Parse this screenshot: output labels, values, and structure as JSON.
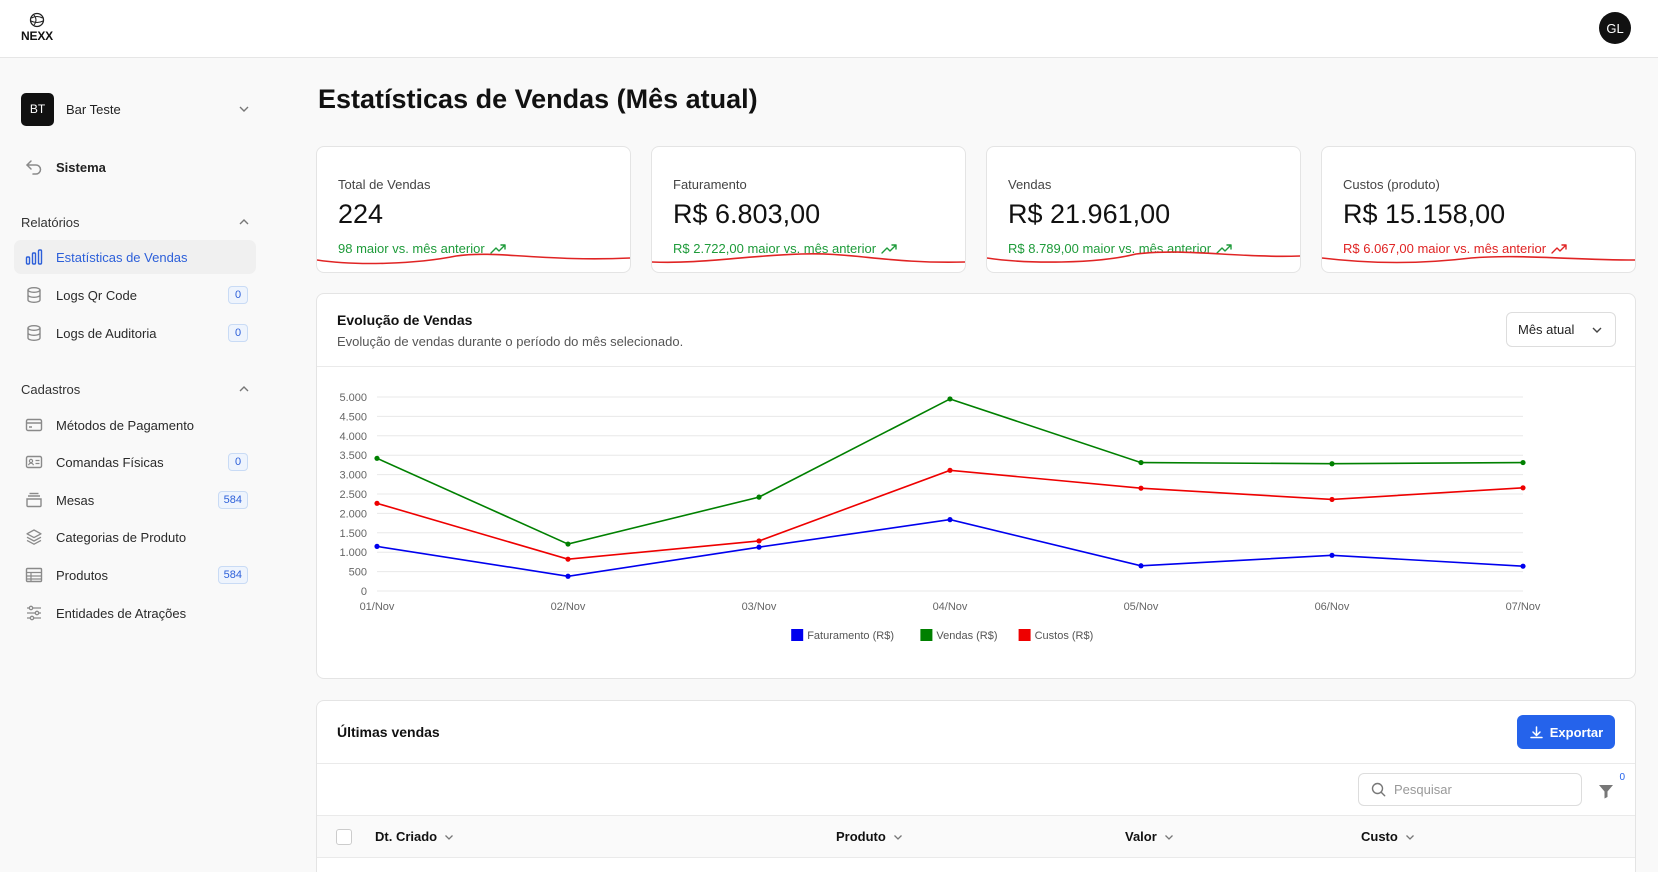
{
  "brand": {
    "name": "NEXX"
  },
  "user": {
    "initials": "GL"
  },
  "sidebar": {
    "org": {
      "initials": "BT",
      "name": "Bar Teste"
    },
    "system_label": "Sistema",
    "sections": [
      {
        "title": "Relatórios",
        "items": [
          {
            "label": "Estatísticas de Vendas",
            "icon": "bar-chart-icon",
            "active": true
          },
          {
            "label": "Logs Qr Code",
            "icon": "database-icon",
            "count": "0"
          },
          {
            "label": "Logs de Auditoria",
            "icon": "database-icon",
            "count": "0"
          }
        ]
      },
      {
        "title": "Cadastros",
        "items": [
          {
            "label": "Métodos de Pagamento",
            "icon": "credit-card-icon"
          },
          {
            "label": "Comandas Físicas",
            "icon": "id-card-icon",
            "count": "0"
          },
          {
            "label": "Mesas",
            "icon": "layers-box-icon",
            "count": "584"
          },
          {
            "label": "Categorias de Produto",
            "icon": "layers-icon"
          },
          {
            "label": "Produtos",
            "icon": "table-icon",
            "count": "584"
          },
          {
            "label": "Entidades de Atrações",
            "icon": "sliders-icon"
          }
        ]
      }
    ]
  },
  "page": {
    "title": "Estatísticas de Vendas (Mês atual)"
  },
  "stats": [
    {
      "label": "Total de Vendas",
      "value": "224",
      "delta": "98 maior vs. mês anterior",
      "tone": "positive",
      "color": "#1e9b3a"
    },
    {
      "label": "Faturamento",
      "value": "R$ 6.803,00",
      "delta": "R$ 2.722,00 maior vs. mês anterior",
      "tone": "positive",
      "color": "#1e9b3a"
    },
    {
      "label": "Vendas",
      "value": "R$ 21.961,00",
      "delta": "R$ 8.789,00 maior vs. mês anterior",
      "tone": "positive",
      "color": "#1e9b3a"
    },
    {
      "label": "Custos (produto)",
      "value": "R$ 15.158,00",
      "delta": "R$ 6.067,00 maior vs. mês anterior",
      "tone": "negative",
      "color": "#e02424"
    }
  ],
  "chart_card": {
    "title": "Evolução de Vendas",
    "subtitle": "Evolução de vendas durante o período do mês selecionado.",
    "period": "Mês atual"
  },
  "chart_data": {
    "type": "line",
    "x": [
      "01/Nov",
      "02/Nov",
      "03/Nov",
      "04/Nov",
      "05/Nov",
      "06/Nov",
      "07/Nov"
    ],
    "y_ticks": [
      "0",
      "500",
      "1.000",
      "1.500",
      "2.000",
      "2.500",
      "3.000",
      "3.500",
      "4.000",
      "4.500",
      "5.000"
    ],
    "ylim": [
      0,
      5000
    ],
    "grid": true,
    "legend_position": "bottom-center",
    "series": [
      {
        "name": "Faturamento (R$)",
        "color": "#0000ee",
        "values": [
          1150,
          380,
          1130,
          1840,
          650,
          920,
          640
        ]
      },
      {
        "name": "Vendas (R$)",
        "color": "#008000",
        "values": [
          3420,
          1210,
          2420,
          4950,
          3310,
          3280,
          3310
        ]
      },
      {
        "name": "Custos (R$)",
        "color": "#ee0000",
        "values": [
          2260,
          820,
          1290,
          3110,
          2650,
          2360,
          2660
        ]
      }
    ]
  },
  "sales": {
    "title": "Últimas vendas",
    "export_label": "Exportar",
    "search_placeholder": "Pesquisar",
    "filter_count": "0",
    "columns": [
      "Dt. Criado",
      "Produto",
      "Valor",
      "Custo"
    ]
  }
}
